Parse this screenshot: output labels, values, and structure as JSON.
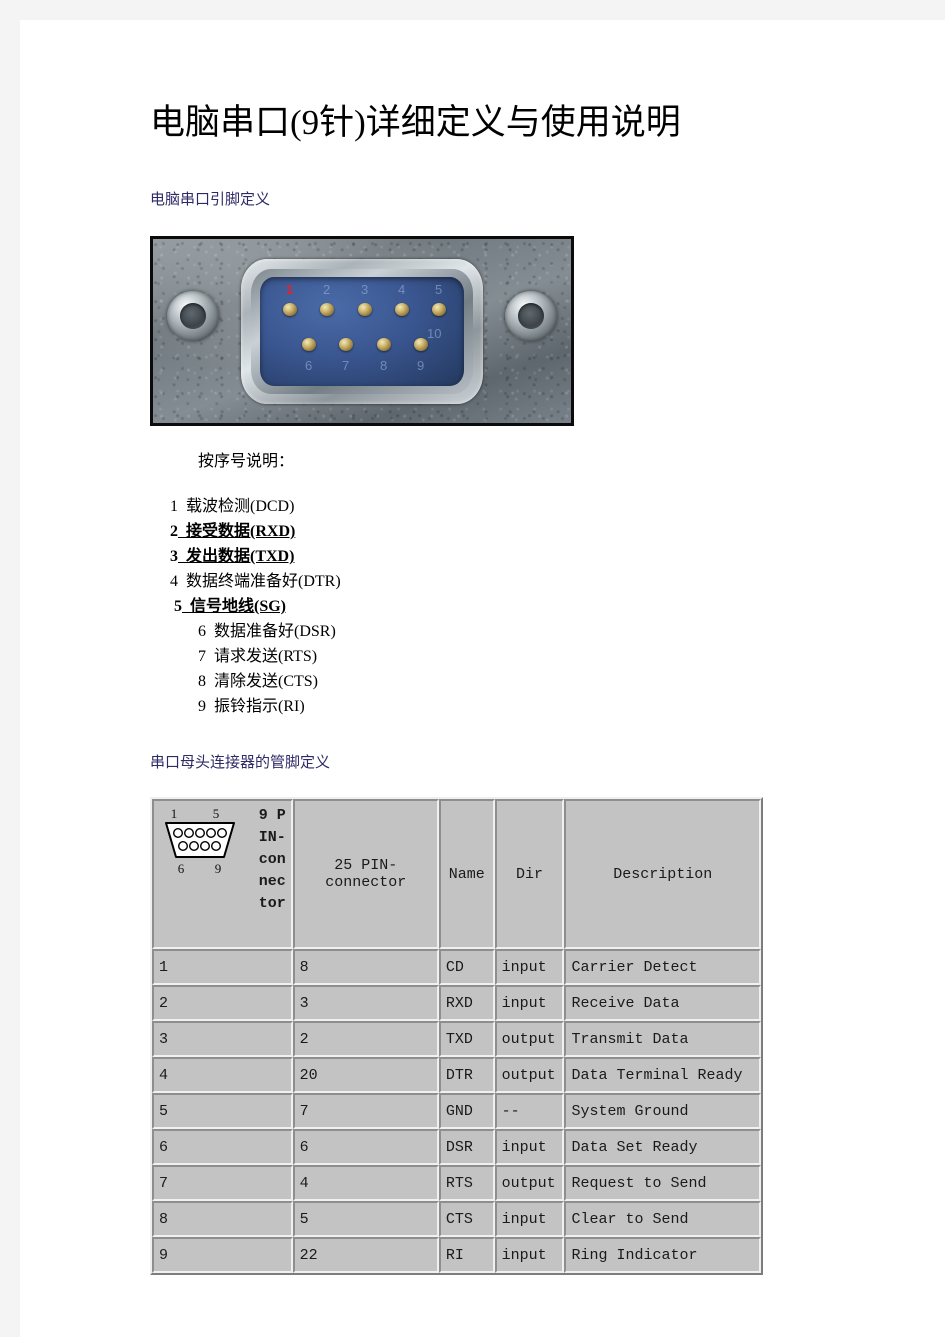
{
  "document": {
    "title": "电脑串口(9针)详细定义与使用说明",
    "section1_heading": "电脑串口引脚定义",
    "section2_heading": "串口母头连接器的管脚定义",
    "heading_color": "#2e2a66"
  },
  "photo": {
    "alt": "DE-9 male serial port connector photograph",
    "insert_color": "#3a5690",
    "pin1_marker_color": "#e8202a",
    "top_row_numbers": [
      "1",
      "2",
      "3",
      "4",
      "5"
    ],
    "bottom_row_numbers": [
      "6",
      "7",
      "8",
      "9"
    ],
    "extra_label": "10"
  },
  "pin_list": {
    "intro": "按序号说明：",
    "items": [
      {
        "no": "1",
        "label": "载波检测(DCD)",
        "emphasis": false,
        "indent": 0
      },
      {
        "no": "2",
        "label": "接受数据(RXD)",
        "emphasis": true,
        "indent": 0
      },
      {
        "no": "3",
        "label": "发出数据(TXD)",
        "emphasis": true,
        "indent": 0
      },
      {
        "no": "4",
        "label": "数据终端准备好(DTR)",
        "emphasis": false,
        "indent": 0
      },
      {
        "no": "5",
        "label": "信号地线(SG)",
        "emphasis": true,
        "indent": 1
      },
      {
        "no": "6",
        "label": "数据准备好(DSR)",
        "emphasis": false,
        "indent": 2
      },
      {
        "no": "7",
        "label": "请求发送(RTS)",
        "emphasis": false,
        "indent": 2
      },
      {
        "no": "8",
        "label": "清除发送(CTS)",
        "emphasis": false,
        "indent": 2
      },
      {
        "no": "9",
        "label": "振铃指示(RI)",
        "emphasis": false,
        "indent": 2
      }
    ]
  },
  "table": {
    "connector_diagram": {
      "top_left_number": "1",
      "top_right_number": "5",
      "bottom_left_number": "6",
      "bottom_right_number": "9",
      "top_row_holes": 5,
      "bottom_row_holes": 4
    },
    "headers": {
      "connector9": "9 PIN-connector",
      "connector25": "25 PIN-connector",
      "name": "Name",
      "dir": "Dir",
      "description": "Description"
    },
    "rows": [
      {
        "pin9": "1",
        "pin25": "8",
        "name": "CD",
        "dir": "input",
        "desc": "Carrier Detect"
      },
      {
        "pin9": "2",
        "pin25": "3",
        "name": "RXD",
        "dir": "input",
        "desc": "Receive Data"
      },
      {
        "pin9": "3",
        "pin25": "2",
        "name": "TXD",
        "dir": "output",
        "desc": "Transmit Data"
      },
      {
        "pin9": "4",
        "pin25": "20",
        "name": "DTR",
        "dir": "output",
        "desc": "Data Terminal Ready"
      },
      {
        "pin9": "5",
        "pin25": "7",
        "name": "GND",
        "dir": "--",
        "desc": "System Ground"
      },
      {
        "pin9": "6",
        "pin25": "6",
        "name": "DSR",
        "dir": "input",
        "desc": "Data Set Ready"
      },
      {
        "pin9": "7",
        "pin25": "4",
        "name": "RTS",
        "dir": "output",
        "desc": "Request to Send"
      },
      {
        "pin9": "8",
        "pin25": "5",
        "name": "CTS",
        "dir": "input",
        "desc": "Clear to Send"
      },
      {
        "pin9": "9",
        "pin25": "22",
        "name": "RI",
        "dir": "input",
        "desc": "Ring Indicator"
      }
    ]
  }
}
